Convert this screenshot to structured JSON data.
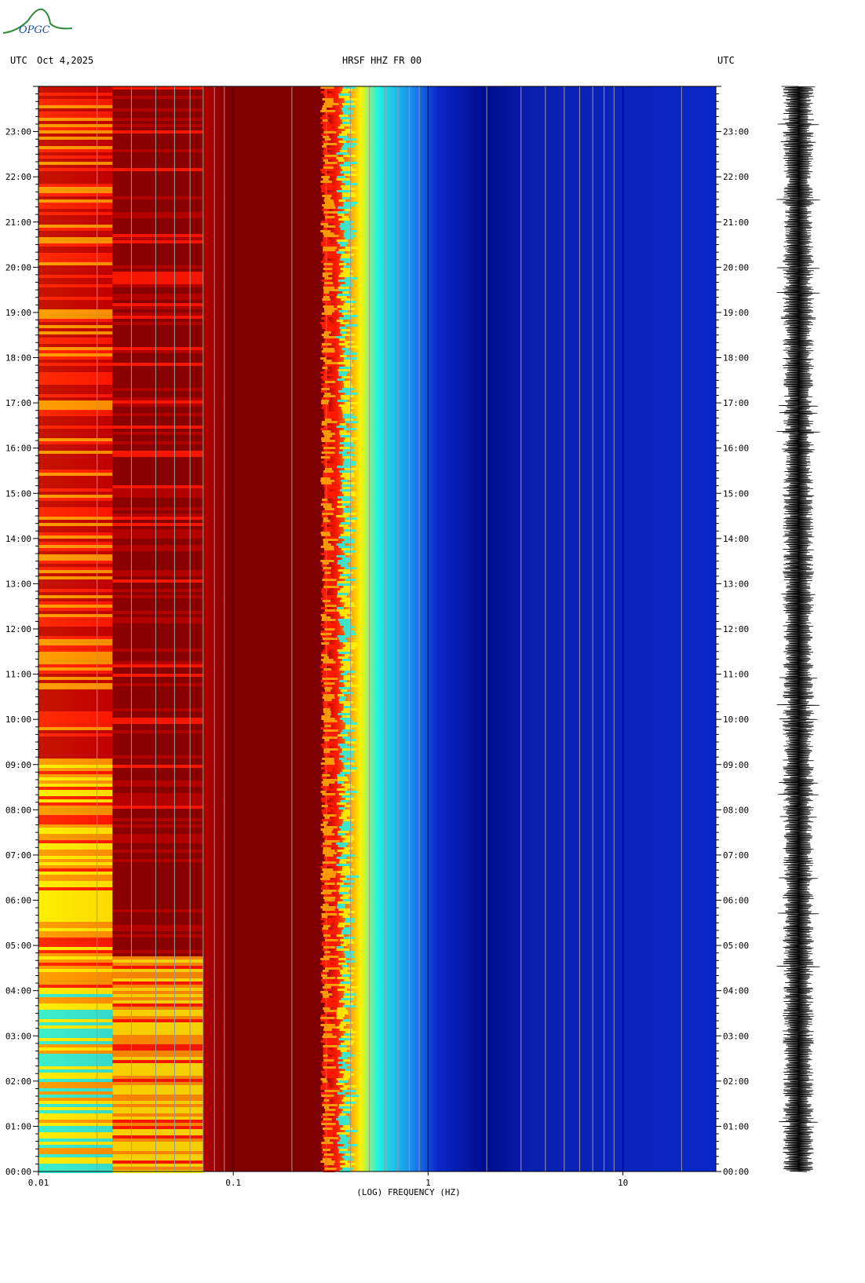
{
  "logo": {
    "text": "OPGC",
    "icon": "opgc-volcano-logo"
  },
  "header": {
    "left_tz": "UTC",
    "date": "Oct 4,2025",
    "station": "HRSF HHZ FR 00",
    "right_tz": "UTC"
  },
  "colors": {
    "hot_low": "#800000",
    "red": "#ff1a00",
    "orange": "#ff9a00",
    "yellow": "#fff200",
    "cyan": "#27f2e0",
    "blue": "#0a27c8",
    "dark_blue": "#000c8c",
    "grid": "#9a9a9a"
  },
  "chart_data": {
    "type": "heatmap",
    "title": "HRSF HHZ FR 00",
    "xlabel": "(LOG) FREQUENCY (HZ)",
    "x_scale": "log",
    "xlim": [
      0.01,
      30
    ],
    "x_ticks": [
      "0.01",
      "0.1",
      "1",
      "10"
    ],
    "y_unit": "UTC",
    "ylim": [
      "00:00",
      "24:00"
    ],
    "y_ticks": [
      "00:00",
      "01:00",
      "02:00",
      "03:00",
      "04:00",
      "05:00",
      "06:00",
      "07:00",
      "08:00",
      "09:00",
      "10:00",
      "11:00",
      "12:00",
      "13:00",
      "14:00",
      "15:00",
      "16:00",
      "17:00",
      "18:00",
      "19:00",
      "20:00",
      "21:00",
      "22:00",
      "23:00"
    ],
    "grid": true,
    "colormap": "jet",
    "power_profile": [
      {
        "freq": 0.01,
        "level": "yellow-red (varies with hour)"
      },
      {
        "freq": 0.1,
        "level": "dark red"
      },
      {
        "freq": 0.3,
        "level": "red-orange"
      },
      {
        "freq": 0.4,
        "level": "yellow-cyan"
      },
      {
        "freq": 0.6,
        "level": "blue"
      },
      {
        "freq": 2,
        "level": "dark blue"
      }
    ],
    "side_trace": "seismogram"
  }
}
